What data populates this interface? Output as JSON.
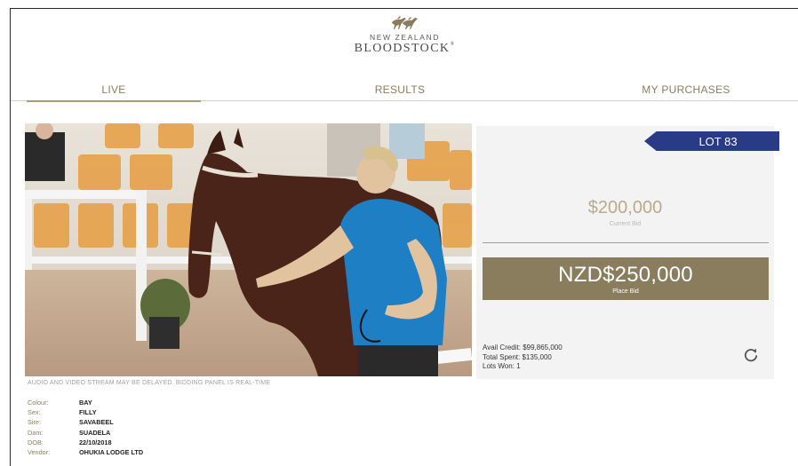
{
  "brand": {
    "line1": "NEW ZEALAND",
    "line2": "BLOODSTOCK",
    "mark": "®"
  },
  "tabs": [
    {
      "label": "LIVE",
      "active": true
    },
    {
      "label": "RESULTS",
      "active": false
    },
    {
      "label": "MY PURCHASES",
      "active": false
    }
  ],
  "stream_note": "AUDIO AND VIDEO STREAM MAY BE DELAYED. BIDDING PANEL IS REAL-TIME",
  "lot": {
    "label": "LOT 83"
  },
  "bid": {
    "current_amount": "$200,000",
    "current_label": "Current Bid",
    "place_amount": "NZD$250,000",
    "place_label": "Place Bid"
  },
  "account": {
    "avail_credit": "Avail Credit: $99,865,000",
    "total_spent": "Total Spent: $135,000",
    "lots_won": "Lots Won: 1"
  },
  "horse": [
    {
      "label": "Colour:",
      "value": "BAY"
    },
    {
      "label": "Sex:",
      "value": "FILLY"
    },
    {
      "label": "Sire:",
      "value": "SAVABEEL"
    },
    {
      "label": "Dam:",
      "value": "SUADELA"
    },
    {
      "label": "DOB:",
      "value": "22/10/2018"
    },
    {
      "label": "Vendor:",
      "value": "OHUKIA LODGE LTD"
    }
  ],
  "icons": {
    "logo": "horses-logo-icon",
    "refresh": "refresh-icon"
  },
  "colors": {
    "gold": "#8a7d5e",
    "lot_badge": "#293a86",
    "panel": "#f3f3f3"
  }
}
